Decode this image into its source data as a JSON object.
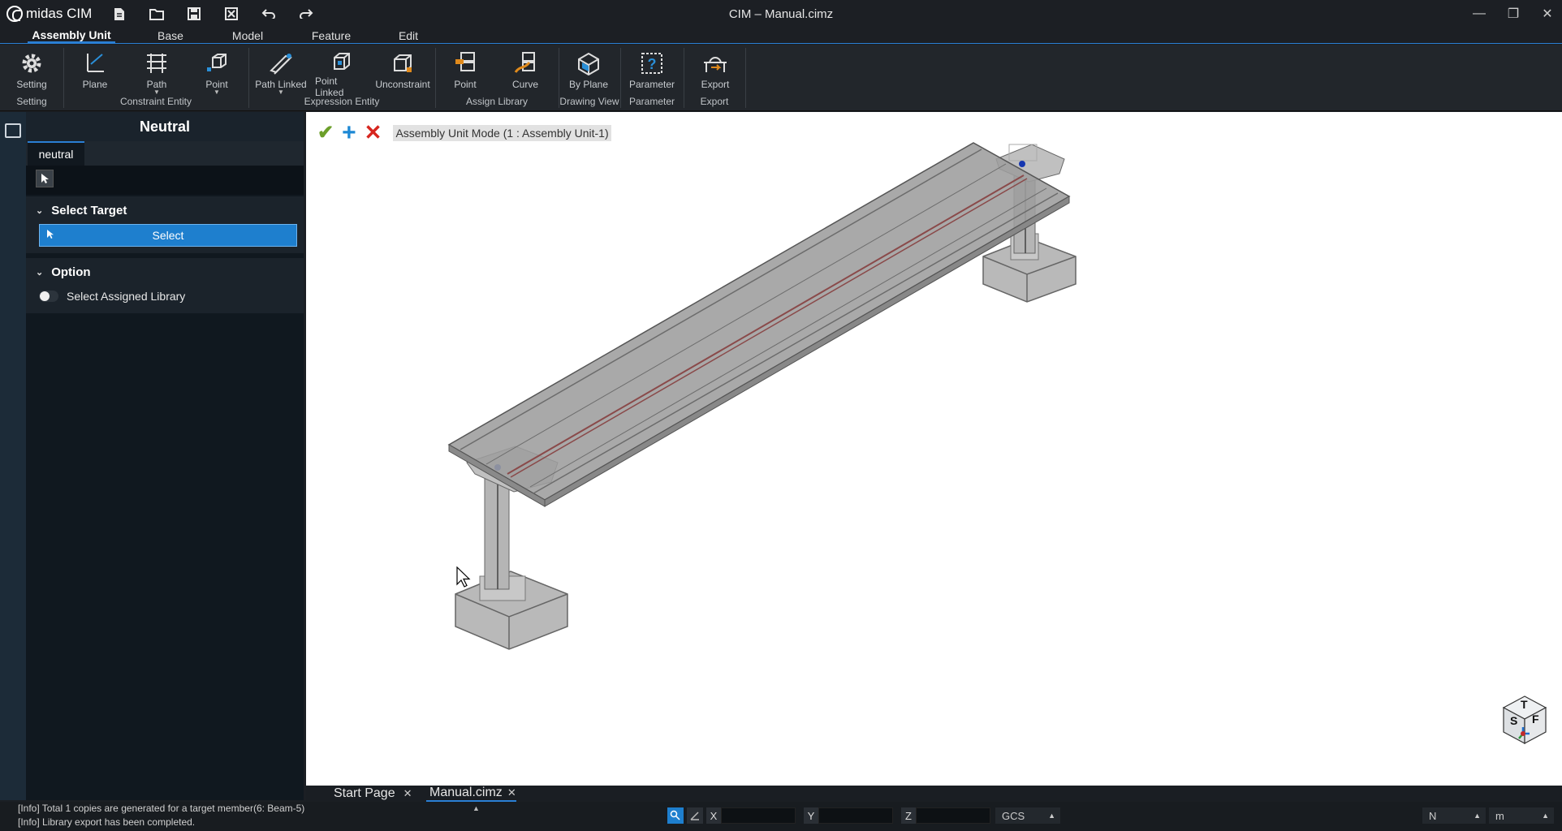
{
  "app": {
    "logo": "midas CIM",
    "title": "CIM – Manual.cimz"
  },
  "quick_access": [
    "new-file-icon",
    "open-folder-icon",
    "save-icon",
    "close-file-icon",
    "undo-icon",
    "redo-icon"
  ],
  "menu_tabs": [
    {
      "label": "Assembly Unit",
      "active": true
    },
    {
      "label": "Base"
    },
    {
      "label": "Model"
    },
    {
      "label": "Feature"
    },
    {
      "label": "Edit"
    }
  ],
  "ribbon": {
    "buttons": [
      {
        "label": "Setting",
        "icon": "gear-icon"
      },
      {
        "label": "Plane",
        "icon": "plane-icon"
      },
      {
        "label": "Path",
        "icon": "path-grid-icon",
        "dropdown": true
      },
      {
        "label": "Point",
        "icon": "point-cube-icon",
        "dropdown": true
      },
      {
        "label": "Path Linked",
        "icon": "path-linked-icon",
        "dropdown": true
      },
      {
        "label": "Point Linked",
        "icon": "point-linked-icon"
      },
      {
        "label": "Unconstraint",
        "icon": "unconstraint-icon"
      },
      {
        "label": "Point",
        "icon": "library-point-icon"
      },
      {
        "label": "Curve",
        "icon": "library-curve-icon"
      },
      {
        "label": "By Plane",
        "icon": "by-plane-icon"
      },
      {
        "label": "Parameter",
        "icon": "parameter-icon"
      },
      {
        "label": "Export",
        "icon": "export-icon"
      }
    ],
    "groups": [
      "Setting",
      "Constraint Entity",
      "Expression Entity",
      "Assign Library",
      "Drawing View",
      "Parameter",
      "Export"
    ]
  },
  "panel": {
    "title": "Neutral",
    "tab": "neutral",
    "select_target": {
      "header": "Select Target",
      "button": "Select"
    },
    "option": {
      "header": "Option",
      "toggle_label": "Select Assigned Library",
      "toggle_on": false
    }
  },
  "viewport": {
    "mode_label": "Assembly Unit Mode (1 : Assembly Unit-1)",
    "view_cube": {
      "top": "T",
      "left": "S",
      "right": "F"
    }
  },
  "doc_tabs": [
    {
      "label": "Start Page",
      "active": false
    },
    {
      "label": "Manual.cimz",
      "active": true
    }
  ],
  "status": {
    "messages": [
      "[Info] Total 1 copies are generated for a target member(6: Beam-5)",
      "[Info] Library export has been completed."
    ],
    "coords": {
      "x_label": "X",
      "y_label": "Y",
      "z_label": "Z",
      "system": "GCS"
    },
    "force_unit": "N",
    "length_unit": "m"
  }
}
